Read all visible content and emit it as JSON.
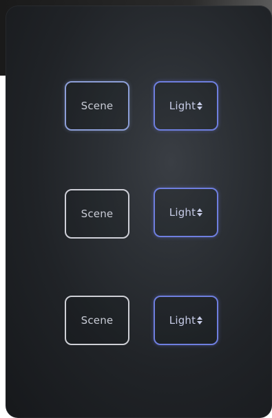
{
  "rows": [
    {
      "scene_label": "Scene",
      "light_label": "Light"
    },
    {
      "scene_label": "Scene",
      "light_label": "Light"
    },
    {
      "scene_label": "Scene",
      "light_label": "Light"
    }
  ],
  "icons": {
    "light_adjust": "up-down-arrows-icon"
  },
  "colors": {
    "panel": "#202327",
    "scene_border_top": "#8d9fd8",
    "scene_border": "#cfd0d8",
    "light_border": "#6f7fe0",
    "text": "#c9ccd6"
  }
}
